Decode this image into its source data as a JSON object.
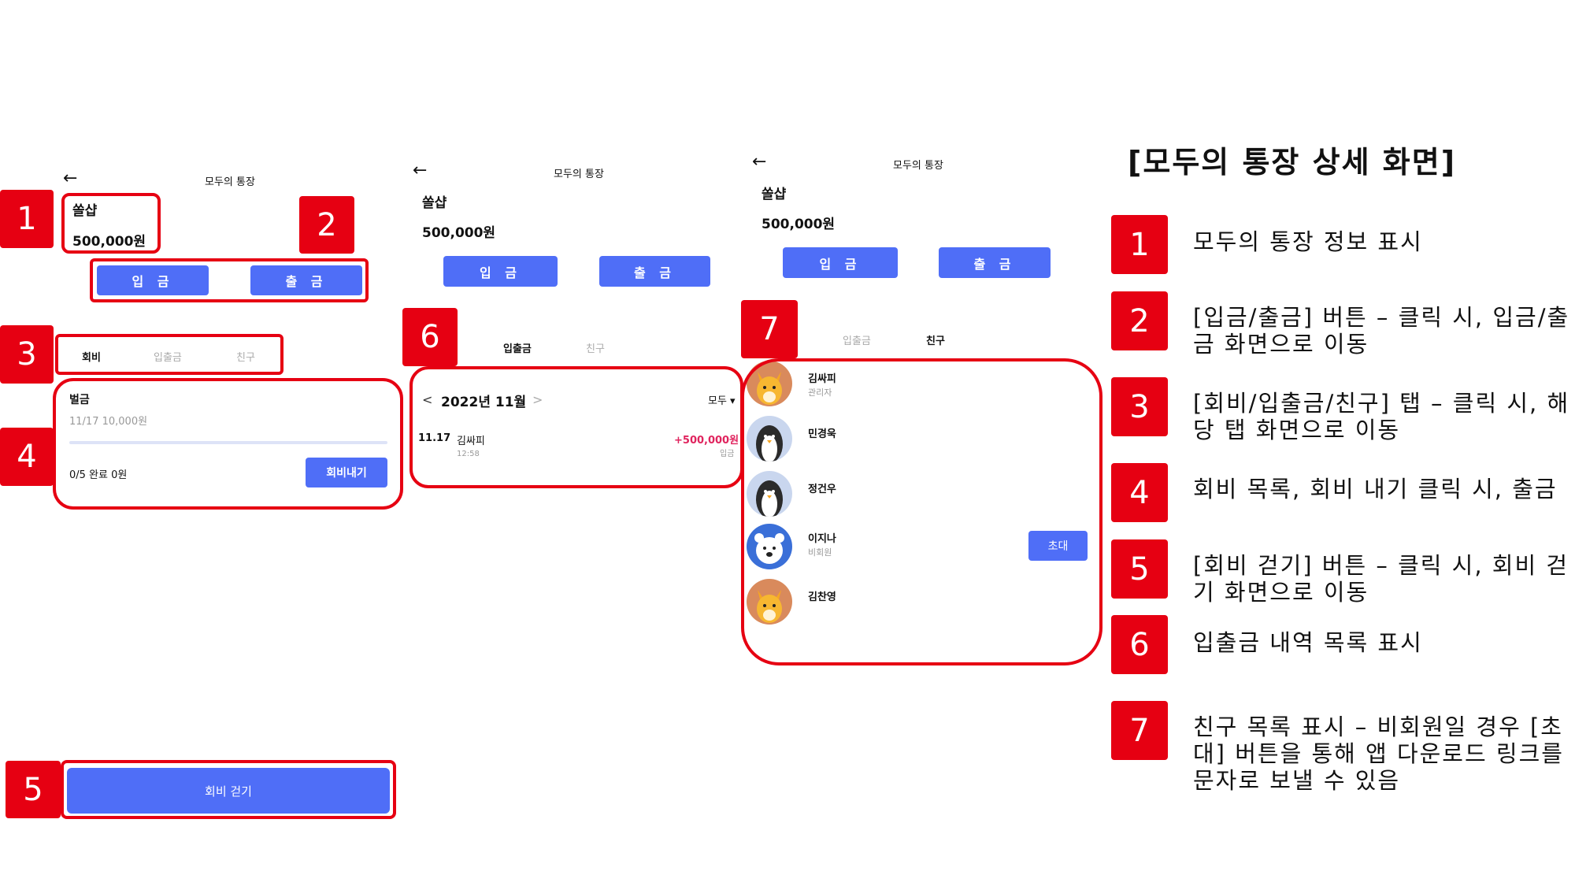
{
  "heading": "[모두의 통장 상세 화면]",
  "screen1": {
    "title": "모두의 통장",
    "account_name": "쏠샵",
    "balance": "500,000원",
    "deposit_btn": "입 금",
    "withdraw_btn": "출 금",
    "tabs": [
      "회비",
      "입출금",
      "친구"
    ],
    "fee_item": {
      "title": "벌금",
      "sub": "11/17  10,000원",
      "progress_pct": 0,
      "status": "0/5 완료  0원",
      "pay_btn": "회비내기"
    },
    "bottom_btn": "회비 걷기"
  },
  "screen2": {
    "title": "모두의 통장",
    "account_name": "쏠샵",
    "balance": "500,000원",
    "deposit_btn": "입 금",
    "withdraw_btn": "출 금",
    "tabs": [
      "입출금",
      "친구"
    ],
    "month_prev": "<",
    "month": "2022년 11월",
    "month_next": ">",
    "filter": "모두 ▾",
    "tx": {
      "date": "11.17",
      "name": "김싸피",
      "time": "12:58",
      "amount": "+500,000원",
      "type": "입금"
    }
  },
  "screen3": {
    "title": "모두의 통장",
    "account_name": "쏠샵",
    "balance": "500,000원",
    "deposit_btn": "입 금",
    "withdraw_btn": "출 금",
    "tabs": [
      "입출금",
      "친구"
    ],
    "invite_btn": "초대",
    "friends": [
      {
        "name": "김싸피",
        "role": "관리자",
        "avatar": "fox-icon"
      },
      {
        "name": "민경욱",
        "role": "",
        "avatar": "penguin-icon"
      },
      {
        "name": "정건우",
        "role": "",
        "avatar": "penguin-icon"
      },
      {
        "name": "이지나",
        "role": "비회원",
        "avatar": "bear-icon"
      },
      {
        "name": "김찬영",
        "role": "",
        "avatar": "fox-icon"
      }
    ]
  },
  "badges": [
    "1",
    "2",
    "3",
    "4",
    "5",
    "6",
    "7"
  ],
  "legend": [
    {
      "num": "1",
      "text": "모두의 통장 정보 표시"
    },
    {
      "num": "2",
      "text": "[입금/출금] 버튼 – 클릭 시, 입금/출금 화면으로 이동"
    },
    {
      "num": "3",
      "text": "[회비/입출금/친구] 탭 – 클릭 시, 해당 탭 화면으로 이동"
    },
    {
      "num": "4",
      "text": "회비 목록, 회비 내기 클릭 시, 출금"
    },
    {
      "num": "5",
      "text": "[회비 걷기] 버튼 – 클릭 시, 회비 걷기 화면으로 이동"
    },
    {
      "num": "6",
      "text": "입출금 내역 목록 표시"
    },
    {
      "num": "7",
      "text": "친구 목록 표시 – 비회원일 경우 [초대] 버튼을 통해 앱 다운로드 링크를 문자로 보낼 수 있음"
    }
  ],
  "colors": {
    "accent": "#4f6ef7",
    "annotation": "#e60012",
    "amount_positive": "#e0245e"
  }
}
